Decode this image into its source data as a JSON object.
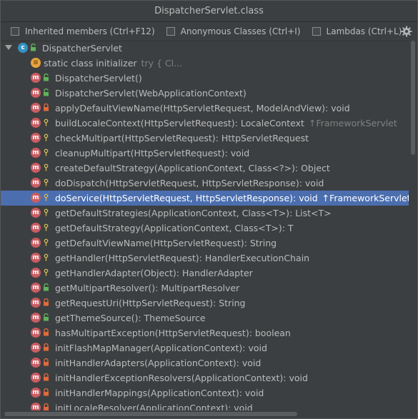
{
  "window": {
    "title": "DispatcherServlet.class"
  },
  "toolbar": {
    "inherited_label": "Inherited members (Ctrl+F12)",
    "anonymous_label": "Anonymous Classes (Ctrl+I)",
    "lambdas_label": "Lambdas (Ctrl+L)"
  },
  "tree": {
    "root": {
      "name": "DispatcherServlet",
      "icon": "class-icon"
    },
    "items": [
      {
        "label": "static class initializer",
        "sub": "try {            Cl...",
        "kind": "static",
        "access": "none"
      },
      {
        "label": "DispatcherServlet()",
        "sub": "",
        "kind": "method",
        "access": "public"
      },
      {
        "label": "DispatcherServlet(WebApplicationContext)",
        "sub": "",
        "kind": "method",
        "access": "public"
      },
      {
        "label": "applyDefaultViewName(HttpServletRequest, ModelAndView): void",
        "sub": "",
        "kind": "method",
        "access": "private"
      },
      {
        "label": "buildLocaleContext(HttpServletRequest): LocaleContext",
        "sub": "↑FrameworkServlet",
        "kind": "method",
        "access": "protected"
      },
      {
        "label": "checkMultipart(HttpServletRequest): HttpServletRequest",
        "sub": "",
        "kind": "method",
        "access": "protected"
      },
      {
        "label": "cleanupMultipart(HttpServletRequest): void",
        "sub": "",
        "kind": "method",
        "access": "protected"
      },
      {
        "label": "createDefaultStrategy(ApplicationContext, Class<?>): Object",
        "sub": "",
        "kind": "method",
        "access": "protected"
      },
      {
        "label": "doDispatch(HttpServletRequest, HttpServletResponse): void",
        "sub": "",
        "kind": "method",
        "access": "protected"
      },
      {
        "label": "doService(HttpServletRequest, HttpServletResponse): void",
        "sub": "↑FrameworkServlet",
        "kind": "method",
        "access": "protected",
        "selected": true
      },
      {
        "label": "getDefaultStrategies(ApplicationContext, Class<T>): List<T>",
        "sub": "",
        "kind": "method",
        "access": "protected"
      },
      {
        "label": "getDefaultStrategy(ApplicationContext, Class<T>): T",
        "sub": "",
        "kind": "method",
        "access": "protected"
      },
      {
        "label": "getDefaultViewName(HttpServletRequest): String",
        "sub": "",
        "kind": "method",
        "access": "protected"
      },
      {
        "label": "getHandler(HttpServletRequest): HandlerExecutionChain",
        "sub": "",
        "kind": "method",
        "access": "protected"
      },
      {
        "label": "getHandlerAdapter(Object): HandlerAdapter",
        "sub": "",
        "kind": "method",
        "access": "protected"
      },
      {
        "label": "getMultipartResolver(): MultipartResolver",
        "sub": "",
        "kind": "method",
        "access": "public"
      },
      {
        "label": "getRequestUri(HttpServletRequest): String",
        "sub": "",
        "kind": "method",
        "access": "private"
      },
      {
        "label": "getThemeSource(): ThemeSource",
        "sub": "",
        "kind": "method",
        "access": "public"
      },
      {
        "label": "hasMultipartException(HttpServletRequest): boolean",
        "sub": "",
        "kind": "method",
        "access": "private"
      },
      {
        "label": "initFlashMapManager(ApplicationContext): void",
        "sub": "",
        "kind": "method",
        "access": "private"
      },
      {
        "label": "initHandlerAdapters(ApplicationContext): void",
        "sub": "",
        "kind": "method",
        "access": "private"
      },
      {
        "label": "initHandlerExceptionResolvers(ApplicationContext): void",
        "sub": "",
        "kind": "method",
        "access": "private"
      },
      {
        "label": "initHandlerMappings(ApplicationContext): void",
        "sub": "",
        "kind": "method",
        "access": "private"
      },
      {
        "label": "initLocaleResolver(ApplicationContext): void",
        "sub": "",
        "kind": "method",
        "access": "private"
      }
    ]
  },
  "colors": {
    "selection": "#4b6eaf",
    "method_icon": "#c85d63",
    "class_icon": "#3592c4",
    "public": "#5fb35a",
    "private": "#e06a3a",
    "protected": "#d4b84f"
  }
}
